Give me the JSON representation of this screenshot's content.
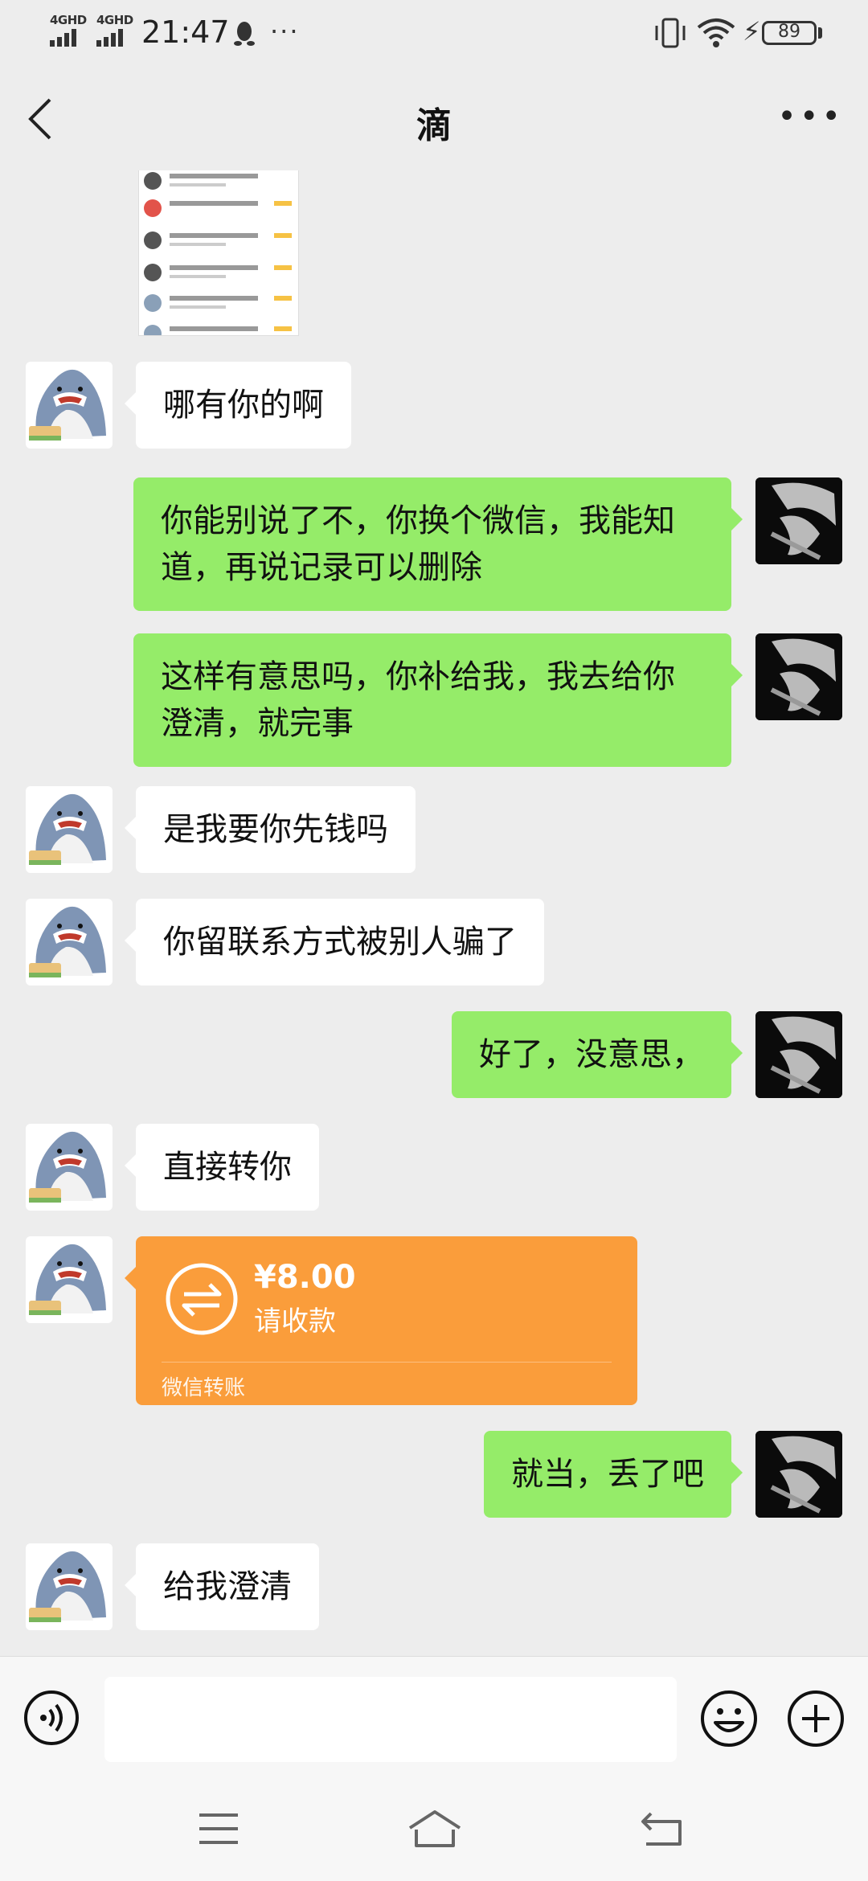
{
  "status_bar": {
    "signal1_label": "4GHD",
    "signal2_label": "4GHD",
    "time": "21:47",
    "battery": "89"
  },
  "header": {
    "title": "滴",
    "back_icon": "chevron-left-icon",
    "more_icon": "more-dots-icon"
  },
  "messages": [
    {
      "side": "left",
      "text": "哪有你的啊"
    },
    {
      "side": "right",
      "text": "你能别说了不，你换个微信，我能知道，再说记录可以删除"
    },
    {
      "side": "right",
      "text": "这样有意思吗，你补给我，我去给你澄清，就完事"
    },
    {
      "side": "left",
      "text": "是我要你先钱吗"
    },
    {
      "side": "left",
      "text": "你留联系方式被别人骗了"
    },
    {
      "side": "right",
      "text": "好了，没意思，"
    },
    {
      "side": "left",
      "text": "直接转你"
    },
    {
      "side": "left",
      "type": "transfer",
      "amount": "¥8.00",
      "status": "请收款",
      "footer": "微信转账"
    },
    {
      "side": "right",
      "text": "就当，丢了吧"
    },
    {
      "side": "left",
      "text": "给我澄清"
    }
  ],
  "input_bar": {
    "voice_icon": "voice-icon",
    "emoji_icon": "emoji-icon",
    "plus_icon": "plus-icon"
  },
  "nav_bar": {
    "icons": [
      "menu-icon",
      "home-icon",
      "back-icon"
    ]
  },
  "colors": {
    "background": "#ededed",
    "outgoing_bubble": "#95ec69",
    "incoming_bubble": "#ffffff",
    "transfer_card": "#fa9d3b"
  }
}
